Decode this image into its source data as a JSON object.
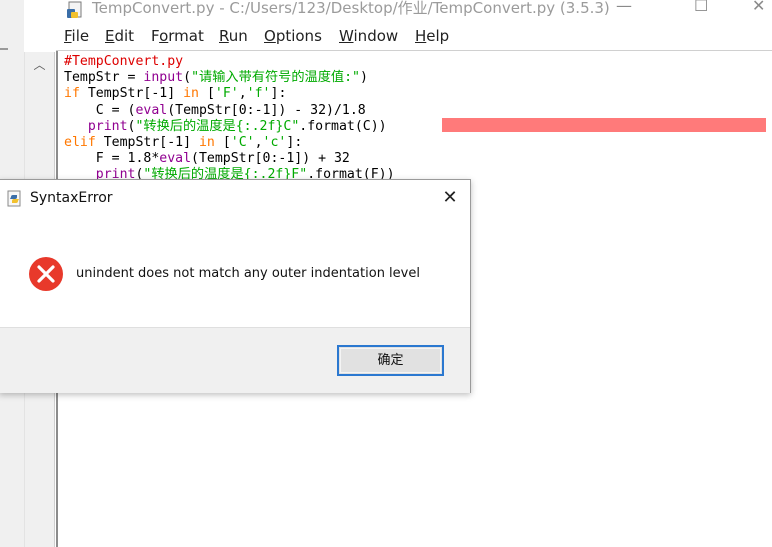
{
  "window": {
    "title": "TempConvert.py - C:/Users/123/Desktop/作业/TempConvert.py (3.5.3)",
    "minimize_symbol": "—",
    "maximize_symbol": "☐",
    "close_symbol": "✕"
  },
  "menu": [
    "File",
    "Edit",
    "Format",
    "Run",
    "Options",
    "Window",
    "Help"
  ],
  "menu_mnemonics": [
    "F",
    "E",
    "o",
    "R",
    "O",
    "W",
    "H"
  ],
  "scrollbar": {
    "up_arrow": "︿"
  },
  "code": {
    "line1": "#TempConvert.py",
    "line2_a": "TempStr = ",
    "line2_b": "input",
    "line2_c": "(",
    "line2_d": "\"请输入带有符号的温度值:\"",
    "line2_e": ")",
    "line3_a": "if",
    "line3_b": " TempStr[-1] ",
    "line3_c": "in",
    "line3_d": " [",
    "line3_e": "'F'",
    "line3_f": ",",
    "line3_g": "'f'",
    "line3_h": "]:",
    "line4_a": "    C = (",
    "line4_b": "eval",
    "line4_c": "(TempStr[0:-1]) - 32)/1.8",
    "line5_a": "   ",
    "line5_b": "print",
    "line5_c": "(",
    "line5_d": "\"转换后的温度是{:.2f}C\"",
    "line5_e": ".format(C))",
    "line6_a": "elif",
    "line6_b": " TempStr[-1] ",
    "line6_c": "in",
    "line6_d": " [",
    "line6_e": "'C'",
    "line6_f": ",",
    "line6_g": "'c'",
    "line6_h": "]:",
    "line7_a": "    F = 1.8*",
    "line7_b": "eval",
    "line7_c": "(TempStr[0:-1]) + 32",
    "line8_a": "    ",
    "line8_b": "print",
    "line8_c": "(",
    "line8_d": "\"转换后的温度是{:.2f}F\"",
    "line8_e": ".format(F))"
  },
  "colors": {
    "keyword": "#ff7700",
    "builtin": "#900090",
    "string": "#00aa00",
    "comment": "#dd0000",
    "error_highlight": "#ff7a7a",
    "ok_button_border": "#2b78d0"
  },
  "dialog": {
    "title": "SyntaxError",
    "close_symbol": "✕",
    "icon": "error-icon",
    "message": "unindent does not match any outer indentation level",
    "ok_label": "确定"
  }
}
